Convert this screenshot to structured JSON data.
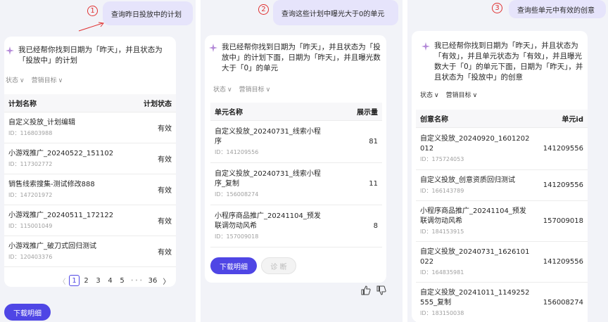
{
  "panel1": {
    "step": "1",
    "query": "查询昨日投放中的计划",
    "ai_message": "我已经帮你找到日期为「昨天」，并且状态为「投放中」的计划",
    "filters": [
      "状态",
      "营销目标"
    ],
    "columns": [
      "计划名称",
      "计划状态"
    ],
    "rows": [
      {
        "name": "自定义投放_计划编辑",
        "id": "ID：116803988",
        "value": "有效"
      },
      {
        "name": "小游戏推广_20240522_151102",
        "id": "ID：117302772",
        "value": "有效"
      },
      {
        "name": "销售线索搜集-测试修改888",
        "id": "ID：147201972",
        "value": "有效"
      },
      {
        "name": "小游戏推广_20240511_172122",
        "id": "ID：115001049",
        "value": "有效"
      },
      {
        "name": "小游戏推广_破刀式回归测试",
        "id": "ID：120403376",
        "value": "有效"
      }
    ],
    "pagination": {
      "prev": "〈",
      "pages": [
        "1",
        "2",
        "3",
        "4",
        "5"
      ],
      "ellipsis": "• • •",
      "last": "36",
      "next": "〉"
    },
    "download_label": "下载明细"
  },
  "panel2": {
    "step": "2",
    "query": "查询这些计划中曝光大于0的单元",
    "ai_message": "我已经帮你找到日期为「昨天」，并且状态为「投放中」的计划下面，日期为「昨天」，并且曝光数大于「0」的单元",
    "filters": [
      "状态",
      "营销目标"
    ],
    "columns": [
      "单元名称",
      "展示量"
    ],
    "rows": [
      {
        "name": "自定义投放_20240731_线索小程序",
        "id": "ID：141209556",
        "value": "81"
      },
      {
        "name": "自定义投放_20240731_线索小程序_复制",
        "id": "ID：156008274",
        "value": "11"
      },
      {
        "name": "小程序商品推广_20241104_预发联调勿动风希",
        "id": "ID：157009018",
        "value": "8"
      }
    ],
    "download_label": "下载明细",
    "diagnose_label": "诊 断"
  },
  "panel3": {
    "step": "3",
    "query": "查询些单元中有效的创意",
    "ai_message": "我已经帮你找到日期为「昨天」，并且状态为「有效」，并且单元状态为「有效」，并且曝光数大于「0」的单元下面，日期为「昨天」，并且状态为「投放中」的创意",
    "filters": [
      "状态",
      "营销目标"
    ],
    "columns": [
      "创意名称",
      "单元id"
    ],
    "rows": [
      {
        "name": "自定义投放_20240920_1601202012",
        "id": "ID：175724053",
        "value": "141209556"
      },
      {
        "name": "自定义投放_创意资质回归测试",
        "id": "ID：166143789",
        "value": "141209556"
      },
      {
        "name": "小程序商品推广_20241104_预发联调勿动风希",
        "id": "ID：184153915",
        "value": "157009018"
      },
      {
        "name": "自定义投放_20240731_1626101022",
        "id": "ID：164835981",
        "value": "141209556"
      },
      {
        "name": "自定义投放_20241011_1149252555_复制",
        "id": "ID：183150038",
        "value": "156008274"
      }
    ]
  },
  "colors": {
    "accent": "#4f46e5",
    "bubble": "#e6e4fb",
    "annotation": "#e03131",
    "panel_bg": "#f2f3f8"
  },
  "icons": [
    "sparkle-icon",
    "chevron-down-icon",
    "thumbs-up-icon",
    "thumbs-down-icon",
    "red-arrow-icon"
  ]
}
